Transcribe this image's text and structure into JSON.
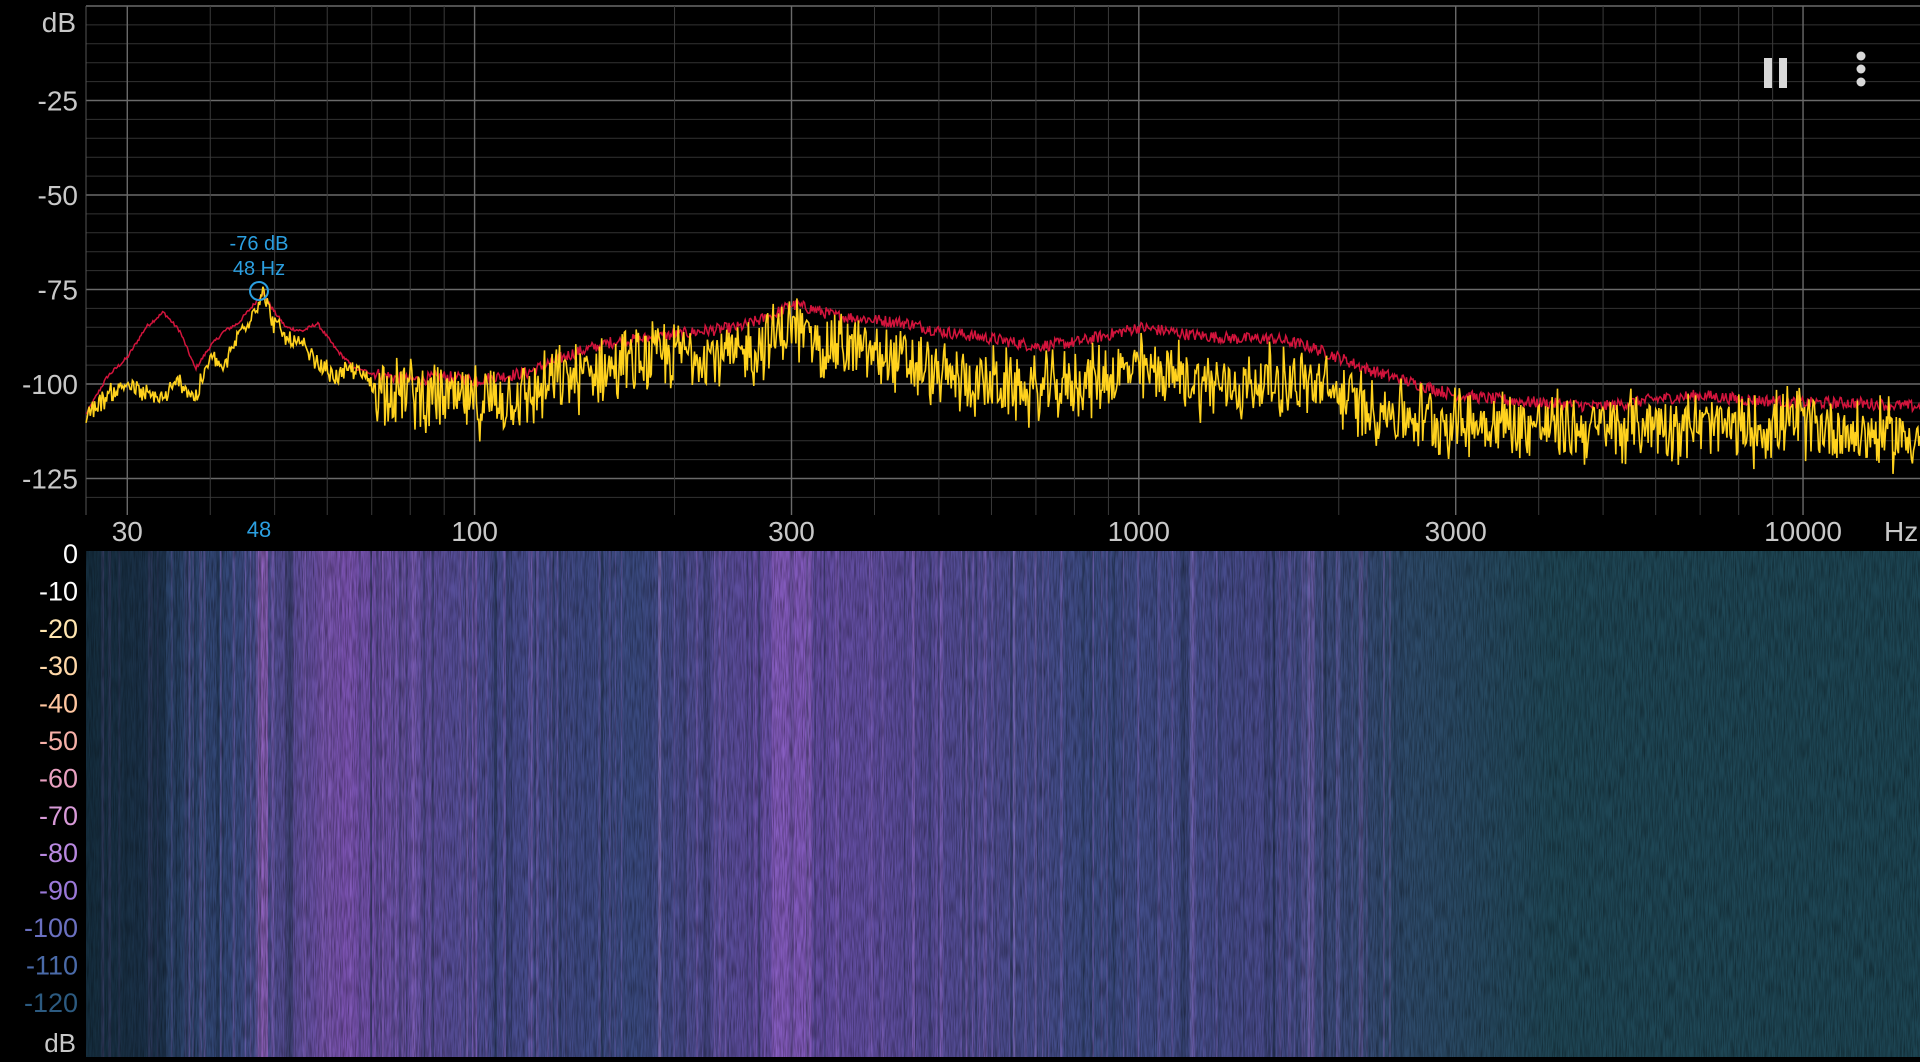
{
  "spectrum": {
    "y_unit": "dB",
    "x_unit": "Hz",
    "y_ticks": [
      "-25",
      "-50",
      "-75",
      "-100",
      "-125"
    ],
    "x_ticks": [
      "30",
      "100",
      "300",
      "1000",
      "3000",
      "10000"
    ],
    "peak": {
      "db_label": "-76 dB",
      "hz_label": "48 Hz",
      "axis_label": "48"
    },
    "colors": {
      "peak_hold": "#d2143c",
      "live": "#ffd21e",
      "marker": "#2b9fe0",
      "grid": "#5a5a5a"
    }
  },
  "spectrogram": {
    "y_unit": "dB",
    "scale_labels": [
      "0",
      "-10",
      "-20",
      "-30",
      "-40",
      "-50",
      "-60",
      "-70",
      "-80",
      "-90",
      "-100",
      "-110",
      "-120"
    ]
  },
  "controls": {
    "pause_icon": "pause-icon",
    "menu_icon": "more-vert-icon"
  },
  "chart_data": {
    "type": "line",
    "x_scale": "log",
    "xlim": [
      26,
      15000
    ],
    "ylim": [
      -135,
      0
    ],
    "ylabel": "dB",
    "xlabel": "Hz",
    "grid": true,
    "series": [
      {
        "x": [
          26,
          28,
          30,
          32,
          34,
          36,
          38,
          40,
          42,
          44,
          46,
          48,
          50,
          52,
          55,
          58,
          62,
          66,
          70,
          80,
          90,
          100,
          120,
          140,
          160,
          180,
          200,
          220,
          250,
          280,
          300,
          320,
          350,
          400,
          450,
          500,
          600,
          700,
          800,
          900,
          1000,
          1100,
          1200,
          1400,
          1600,
          1800,
          2000,
          2200,
          2500,
          3000,
          4000,
          5000,
          6000,
          7000,
          8000,
          10000,
          12000,
          15000
        ],
        "y": [
          -108,
          -98,
          -93,
          -85,
          -81,
          -86,
          -96,
          -90,
          -86,
          -84,
          -80,
          -76,
          -81,
          -85,
          -86,
          -84,
          -91,
          -96,
          -97,
          -99,
          -98,
          -99,
          -97,
          -92,
          -89,
          -88,
          -87,
          -86,
          -85,
          -82,
          -79,
          -80,
          -82,
          -83,
          -84,
          -86,
          -88,
          -90,
          -89,
          -87,
          -85,
          -86,
          -87,
          -88,
          -88,
          -90,
          -93,
          -96,
          -99,
          -103,
          -105,
          -106,
          -104,
          -103,
          -104,
          -105,
          -105,
          -106
        ]
      },
      {
        "x": [
          26,
          28,
          30,
          32,
          34,
          36,
          38,
          40,
          42,
          44,
          46,
          48,
          50,
          52,
          55,
          58,
          62,
          66,
          70,
          80,
          90,
          100,
          120,
          140,
          160,
          180,
          200,
          220,
          250,
          280,
          300,
          320,
          350,
          400,
          450,
          500,
          600,
          700,
          800,
          900,
          1000,
          1100,
          1200,
          1400,
          1600,
          1800,
          2000,
          2200,
          2500,
          3000,
          4000,
          5000,
          6000,
          7000,
          8000,
          10000,
          12000,
          15000
        ],
        "y": [
          -108,
          -103,
          -100,
          -103,
          -104,
          -99,
          -104,
          -93,
          -96,
          -87,
          -82,
          -76,
          -84,
          -88,
          -90,
          -95,
          -98,
          -96,
          -100,
          -102,
          -104,
          -105,
          -103,
          -98,
          -96,
          -94,
          -92,
          -91,
          -93,
          -88,
          -85,
          -88,
          -90,
          -92,
          -95,
          -98,
          -100,
          -102,
          -100,
          -98,
          -96,
          -97,
          -99,
          -101,
          -99,
          -100,
          -103,
          -106,
          -108,
          -110,
          -111,
          -112,
          -110,
          -111,
          -112,
          -110,
          -113,
          -114
        ]
      }
    ]
  }
}
